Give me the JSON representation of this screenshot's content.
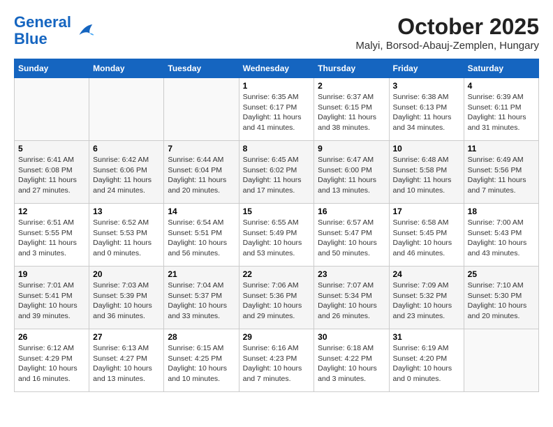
{
  "header": {
    "logo_line1": "General",
    "logo_line2": "Blue",
    "month": "October 2025",
    "location": "Malyi, Borsod-Abauj-Zemplen, Hungary"
  },
  "weekdays": [
    "Sunday",
    "Monday",
    "Tuesday",
    "Wednesday",
    "Thursday",
    "Friday",
    "Saturday"
  ],
  "weeks": [
    [
      {
        "day": "",
        "info": ""
      },
      {
        "day": "",
        "info": ""
      },
      {
        "day": "",
        "info": ""
      },
      {
        "day": "1",
        "info": "Sunrise: 6:35 AM\nSunset: 6:17 PM\nDaylight: 11 hours\nand 41 minutes."
      },
      {
        "day": "2",
        "info": "Sunrise: 6:37 AM\nSunset: 6:15 PM\nDaylight: 11 hours\nand 38 minutes."
      },
      {
        "day": "3",
        "info": "Sunrise: 6:38 AM\nSunset: 6:13 PM\nDaylight: 11 hours\nand 34 minutes."
      },
      {
        "day": "4",
        "info": "Sunrise: 6:39 AM\nSunset: 6:11 PM\nDaylight: 11 hours\nand 31 minutes."
      }
    ],
    [
      {
        "day": "5",
        "info": "Sunrise: 6:41 AM\nSunset: 6:08 PM\nDaylight: 11 hours\nand 27 minutes."
      },
      {
        "day": "6",
        "info": "Sunrise: 6:42 AM\nSunset: 6:06 PM\nDaylight: 11 hours\nand 24 minutes."
      },
      {
        "day": "7",
        "info": "Sunrise: 6:44 AM\nSunset: 6:04 PM\nDaylight: 11 hours\nand 20 minutes."
      },
      {
        "day": "8",
        "info": "Sunrise: 6:45 AM\nSunset: 6:02 PM\nDaylight: 11 hours\nand 17 minutes."
      },
      {
        "day": "9",
        "info": "Sunrise: 6:47 AM\nSunset: 6:00 PM\nDaylight: 11 hours\nand 13 minutes."
      },
      {
        "day": "10",
        "info": "Sunrise: 6:48 AM\nSunset: 5:58 PM\nDaylight: 11 hours\nand 10 minutes."
      },
      {
        "day": "11",
        "info": "Sunrise: 6:49 AM\nSunset: 5:56 PM\nDaylight: 11 hours\nand 7 minutes."
      }
    ],
    [
      {
        "day": "12",
        "info": "Sunrise: 6:51 AM\nSunset: 5:55 PM\nDaylight: 11 hours\nand 3 minutes."
      },
      {
        "day": "13",
        "info": "Sunrise: 6:52 AM\nSunset: 5:53 PM\nDaylight: 11 hours\nand 0 minutes."
      },
      {
        "day": "14",
        "info": "Sunrise: 6:54 AM\nSunset: 5:51 PM\nDaylight: 10 hours\nand 56 minutes."
      },
      {
        "day": "15",
        "info": "Sunrise: 6:55 AM\nSunset: 5:49 PM\nDaylight: 10 hours\nand 53 minutes."
      },
      {
        "day": "16",
        "info": "Sunrise: 6:57 AM\nSunset: 5:47 PM\nDaylight: 10 hours\nand 50 minutes."
      },
      {
        "day": "17",
        "info": "Sunrise: 6:58 AM\nSunset: 5:45 PM\nDaylight: 10 hours\nand 46 minutes."
      },
      {
        "day": "18",
        "info": "Sunrise: 7:00 AM\nSunset: 5:43 PM\nDaylight: 10 hours\nand 43 minutes."
      }
    ],
    [
      {
        "day": "19",
        "info": "Sunrise: 7:01 AM\nSunset: 5:41 PM\nDaylight: 10 hours\nand 39 minutes."
      },
      {
        "day": "20",
        "info": "Sunrise: 7:03 AM\nSunset: 5:39 PM\nDaylight: 10 hours\nand 36 minutes."
      },
      {
        "day": "21",
        "info": "Sunrise: 7:04 AM\nSunset: 5:37 PM\nDaylight: 10 hours\nand 33 minutes."
      },
      {
        "day": "22",
        "info": "Sunrise: 7:06 AM\nSunset: 5:36 PM\nDaylight: 10 hours\nand 29 minutes."
      },
      {
        "day": "23",
        "info": "Sunrise: 7:07 AM\nSunset: 5:34 PM\nDaylight: 10 hours\nand 26 minutes."
      },
      {
        "day": "24",
        "info": "Sunrise: 7:09 AM\nSunset: 5:32 PM\nDaylight: 10 hours\nand 23 minutes."
      },
      {
        "day": "25",
        "info": "Sunrise: 7:10 AM\nSunset: 5:30 PM\nDaylight: 10 hours\nand 20 minutes."
      }
    ],
    [
      {
        "day": "26",
        "info": "Sunrise: 6:12 AM\nSunset: 4:29 PM\nDaylight: 10 hours\nand 16 minutes."
      },
      {
        "day": "27",
        "info": "Sunrise: 6:13 AM\nSunset: 4:27 PM\nDaylight: 10 hours\nand 13 minutes."
      },
      {
        "day": "28",
        "info": "Sunrise: 6:15 AM\nSunset: 4:25 PM\nDaylight: 10 hours\nand 10 minutes."
      },
      {
        "day": "29",
        "info": "Sunrise: 6:16 AM\nSunset: 4:23 PM\nDaylight: 10 hours\nand 7 minutes."
      },
      {
        "day": "30",
        "info": "Sunrise: 6:18 AM\nSunset: 4:22 PM\nDaylight: 10 hours\nand 3 minutes."
      },
      {
        "day": "31",
        "info": "Sunrise: 6:19 AM\nSunset: 4:20 PM\nDaylight: 10 hours\nand 0 minutes."
      },
      {
        "day": "",
        "info": ""
      }
    ]
  ]
}
